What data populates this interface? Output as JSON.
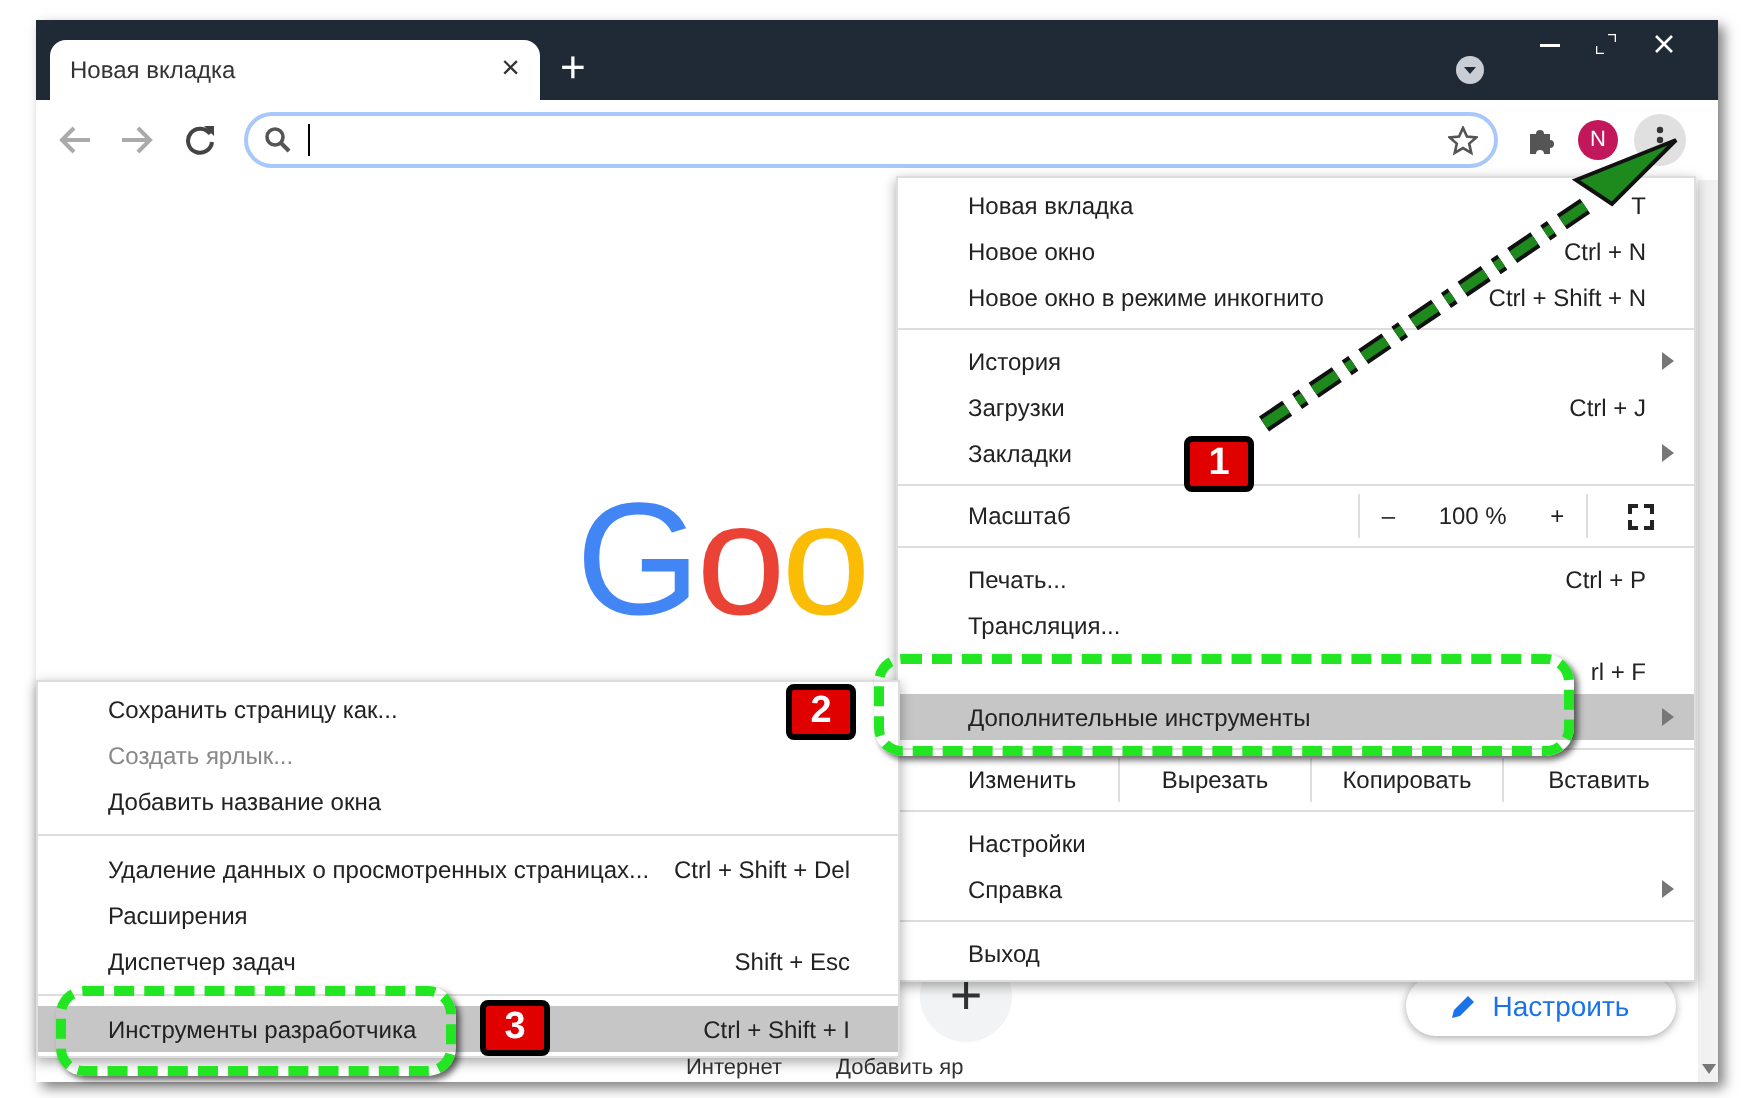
{
  "tab": {
    "title": "Новая вкладка",
    "close": "×"
  },
  "new_tab": "+",
  "avatar": "N",
  "page": {
    "logo": "Goo",
    "customize_button": "Настроить",
    "shortcut_add": "+",
    "shortcut_labels": [
      "Интернет",
      "Добавить яр"
    ]
  },
  "menu": {
    "items": [
      {
        "kind": "item",
        "label": "Новая вкладка",
        "shortcut": "T",
        "submenu": false,
        "selected": false,
        "disabled": false
      },
      {
        "kind": "item",
        "label": "Новое окно",
        "shortcut": "Ctrl + N",
        "submenu": false,
        "selected": false,
        "disabled": false
      },
      {
        "kind": "item",
        "label": "Новое окно в режиме инкогнито",
        "shortcut": "Ctrl + Shift + N",
        "submenu": false,
        "selected": false,
        "disabled": false
      },
      {
        "kind": "separator"
      },
      {
        "kind": "item",
        "label": "История",
        "submenu": true,
        "selected": false,
        "disabled": false
      },
      {
        "kind": "item",
        "label": "Загрузки",
        "shortcut": "Ctrl + J",
        "submenu": false,
        "selected": false,
        "disabled": false
      },
      {
        "kind": "item",
        "label": "Закладки",
        "submenu": true,
        "selected": false,
        "disabled": false
      },
      {
        "kind": "separator"
      },
      {
        "kind": "zoom",
        "label": "Масштаб",
        "minus": "–",
        "value": "100 %",
        "plus": "+"
      },
      {
        "kind": "separator"
      },
      {
        "kind": "item",
        "label": "Печать...",
        "shortcut": "Ctrl + P",
        "submenu": false,
        "selected": false,
        "disabled": false
      },
      {
        "kind": "item",
        "label": "Трансляция...",
        "submenu": false,
        "selected": false,
        "disabled": false
      },
      {
        "kind": "item",
        "shortcut": "rl + F",
        "submenu": false,
        "selected": false,
        "disabled": false
      },
      {
        "kind": "item",
        "label": "Дополнительные инструменты",
        "submenu": true,
        "selected": true,
        "disabled": false
      },
      {
        "kind": "separator"
      },
      {
        "kind": "edit",
        "label": "Изменить",
        "actions": [
          "Вырезать",
          "Копировать",
          "Вставить"
        ]
      },
      {
        "kind": "separator"
      },
      {
        "kind": "item",
        "label": "Настройки",
        "submenu": false,
        "selected": false,
        "disabled": false
      },
      {
        "kind": "item",
        "label": "Справка",
        "submenu": true,
        "selected": false,
        "disabled": false
      },
      {
        "kind": "separator"
      },
      {
        "kind": "item",
        "label": "Выход",
        "submenu": false,
        "selected": false,
        "disabled": false
      }
    ]
  },
  "submenu": {
    "items": [
      {
        "kind": "item",
        "label": "Сохранить страницу как...",
        "submenu": false,
        "selected": false,
        "disabled": false
      },
      {
        "kind": "item",
        "label": "Создать ярлык...",
        "submenu": false,
        "selected": false,
        "disabled": true
      },
      {
        "kind": "item",
        "label": "Добавить название окна",
        "submenu": false,
        "selected": false,
        "disabled": false
      },
      {
        "kind": "separator"
      },
      {
        "kind": "item",
        "label": "Удаление данных о просмотренных страницах...",
        "shortcut": "Ctrl + Shift + Del",
        "submenu": false,
        "selected": false,
        "disabled": false
      },
      {
        "kind": "item",
        "label": "Расширения",
        "submenu": false,
        "selected": false,
        "disabled": false
      },
      {
        "kind": "item",
        "label": "Диспетчер задач",
        "shortcut": "Shift + Esc",
        "submenu": false,
        "selected": false,
        "disabled": false
      },
      {
        "kind": "separator"
      },
      {
        "kind": "item",
        "label": "Инструменты разработчика",
        "shortcut": "Ctrl + Shift + I",
        "submenu": false,
        "selected": true,
        "disabled": false
      }
    ]
  },
  "callouts": [
    "1",
    "2",
    "3"
  ]
}
